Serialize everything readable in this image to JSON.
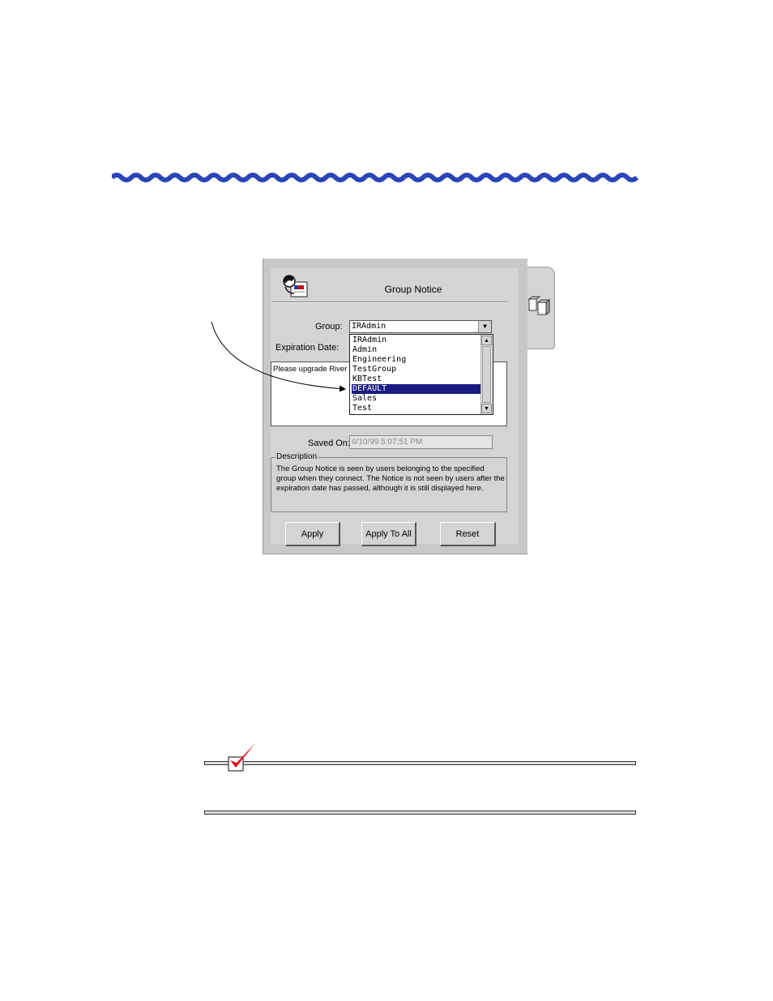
{
  "dialog": {
    "title": "Group Notice",
    "group_label": "Group:",
    "group_value": "IRAdmin",
    "expiration_label": "Expiration Date:",
    "message_text": "Please upgrade River",
    "group_options": [
      "IRAdmin",
      "Admin",
      "Engineering",
      "TestGroup",
      "KBTest",
      "DEFAULT",
      "Sales",
      "Test"
    ],
    "selected_option": "DEFAULT",
    "saved_label": "Saved On:",
    "saved_value": "6/10/99 5:07:51 PM",
    "description_legend": "Description",
    "description_text": "The Group Notice is seen by users belonging to the specified group when they connect.  The Notice is not seen by users after the expiration date has passed, although it is still displayed here.",
    "buttons": {
      "apply": "Apply",
      "apply_all": "Apply To All",
      "reset": "Reset"
    }
  },
  "icons": {
    "title": "group-notice-icon",
    "tab": "servers-icon",
    "dropdown": "chevron-down-icon",
    "note": "checkmark-icon"
  },
  "colors": {
    "wave_rule": "#2a45b8",
    "selection": "#1a1a80",
    "checkmark": "#e0101c"
  }
}
